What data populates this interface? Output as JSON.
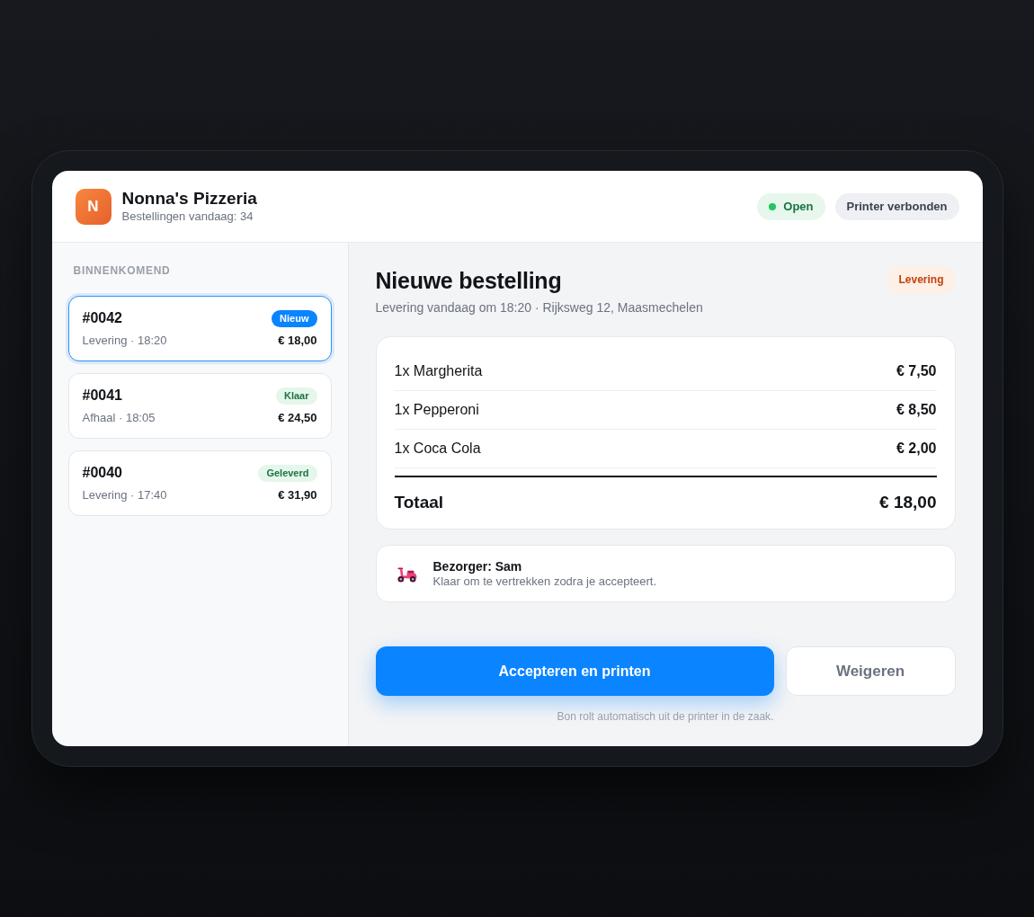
{
  "app": {
    "logo": "N",
    "name": "Nonna's Pizzeria",
    "subtitle": "Bestellingen vandaag: 34",
    "pills": [
      {
        "kind": "status",
        "label": "Open"
      },
      {
        "kind": "info",
        "label": "Printer verbonden"
      }
    ]
  },
  "sidebar": {
    "title": "BINNENKOMEND",
    "orders": [
      {
        "number": "#0042",
        "status": {
          "label": "Nieuw",
          "kind": "new"
        },
        "info": "Levering · 18:20",
        "price": "€ 18,00",
        "selected": true
      },
      {
        "number": "#0041",
        "status": {
          "label": "Klaar",
          "kind": "ready"
        },
        "info": "Afhaal · 18:05",
        "price": "€ 24,50",
        "selected": false
      },
      {
        "number": "#0040",
        "status": {
          "label": "Geleverd",
          "kind": "delivered"
        },
        "info": "Levering · 17:40",
        "price": "€ 31,90",
        "selected": false
      }
    ]
  },
  "order": {
    "title": "Nieuwe bestelling",
    "subtitle": "Levering vandaag om 18:20 · Rijksweg 12, Maasmechelen",
    "type_badge": "Levering",
    "items": [
      {
        "name": "1x Margherita",
        "price": "€ 7,50"
      },
      {
        "name": "1x Pepperoni",
        "price": "€ 8,50"
      },
      {
        "name": "1x Coca Cola",
        "price": "€ 2,00"
      }
    ],
    "total": {
      "label": "Totaal",
      "value": "€ 18,00"
    },
    "courier": {
      "title": "Bezorger: Sam",
      "note": "Klaar om te vertrekken zodra je accepteert."
    },
    "actions": [
      {
        "kind": "primary",
        "label": "Accepteren en printen"
      },
      {
        "kind": "secondary",
        "label": "Weigeren"
      }
    ],
    "footnote": "Bon rolt automatisch uit de printer in de zaak."
  }
}
